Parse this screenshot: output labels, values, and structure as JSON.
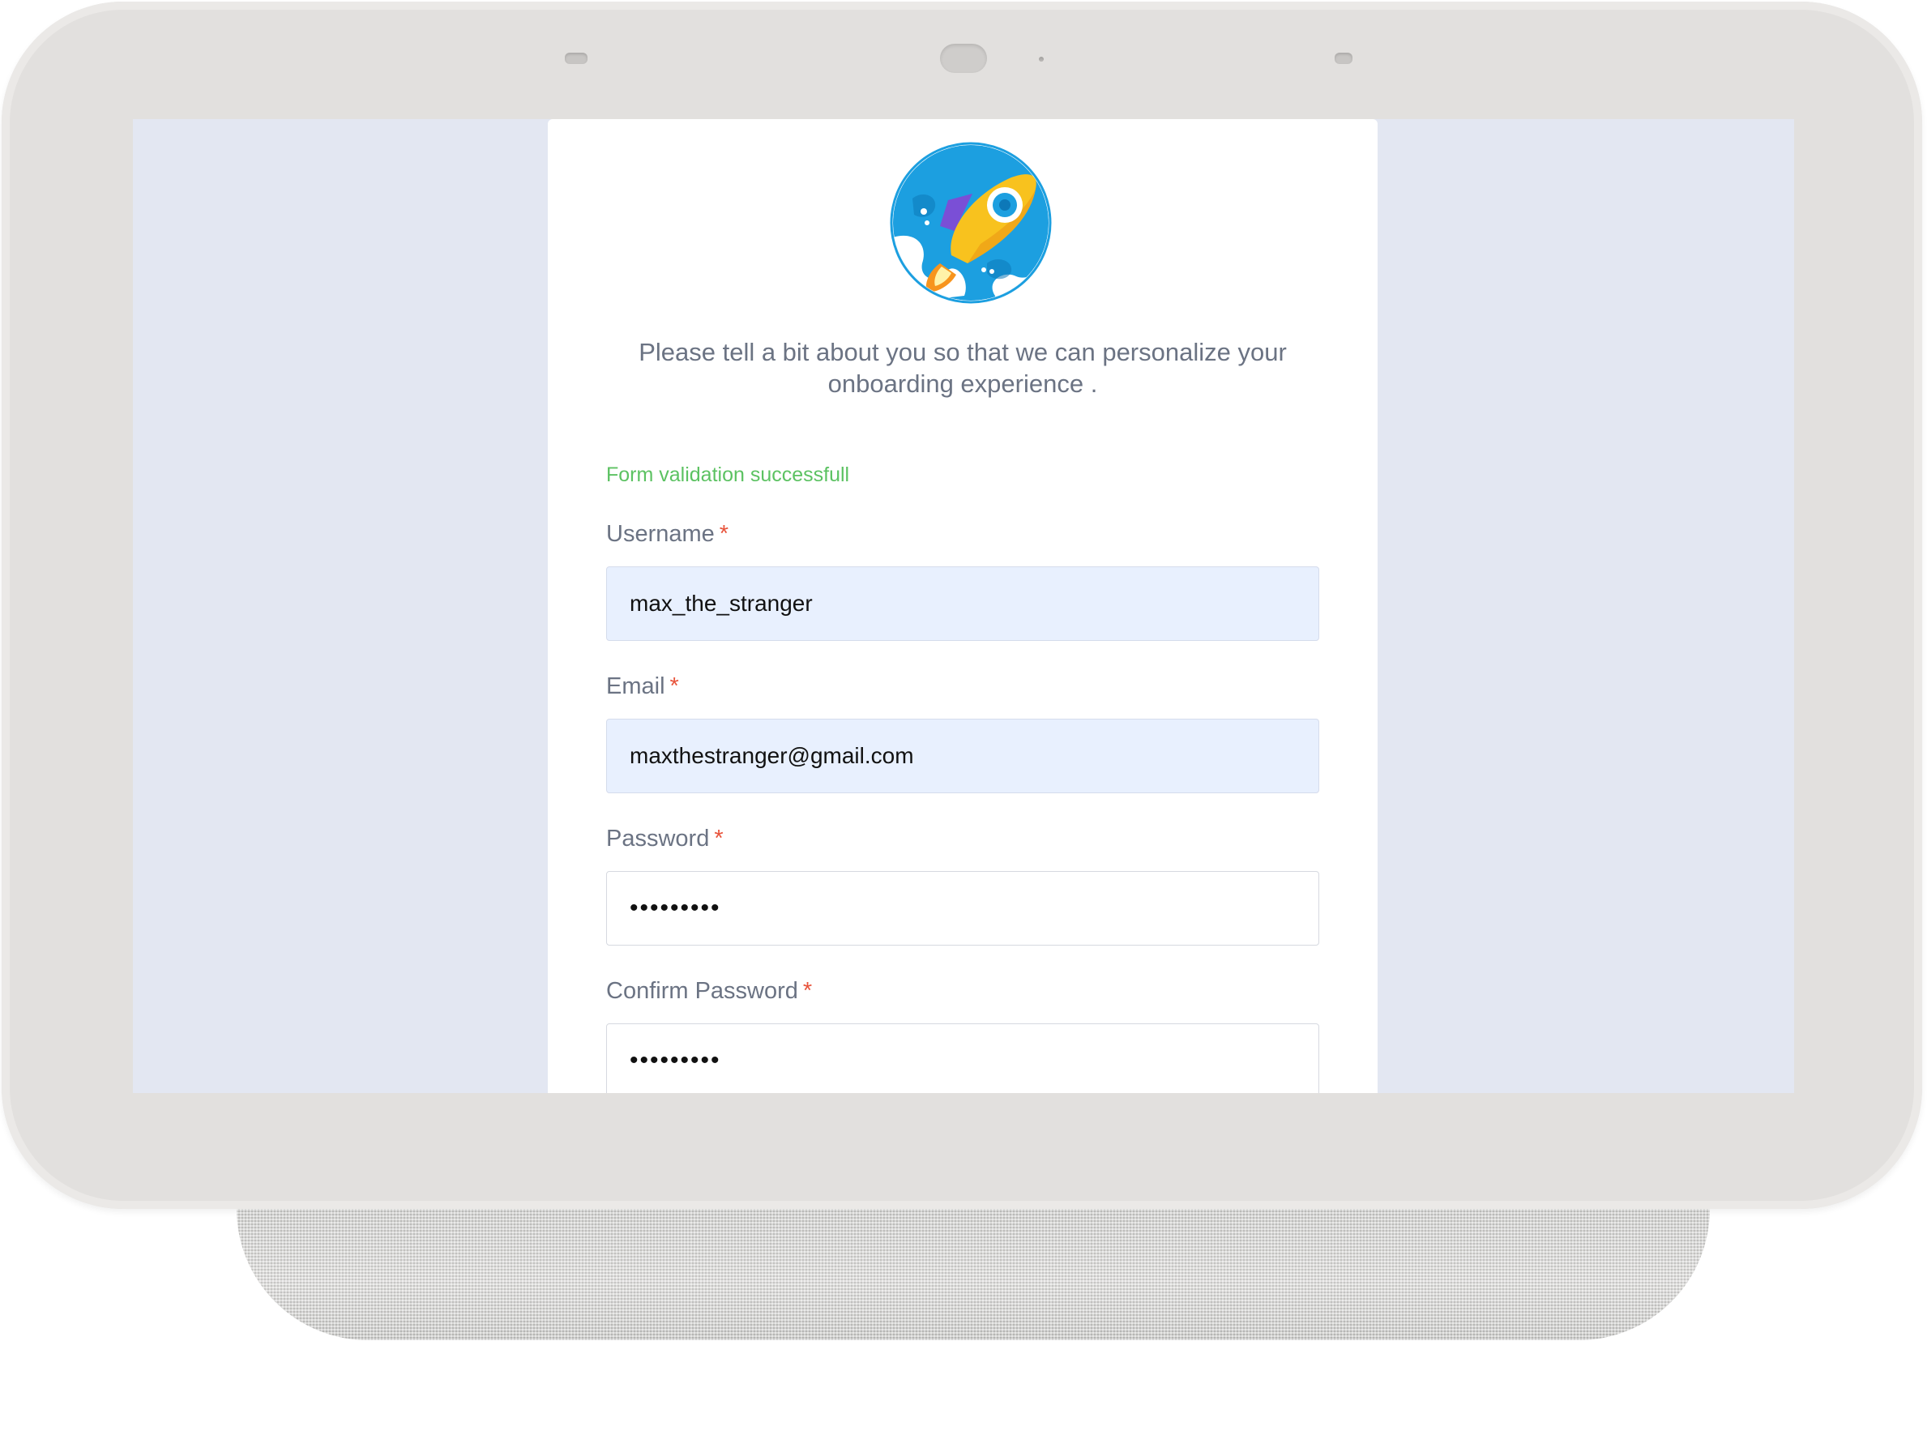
{
  "device": {
    "type": "smart display"
  },
  "logo": {
    "icon": "rocket-logo-icon",
    "colors": {
      "circle": "#1c9fe0",
      "body": "#f8c21e",
      "fin": "#7a4fd6",
      "flame": "#f7941d"
    }
  },
  "intro": {
    "text": "Please tell a bit about you so that we can personalize your onboarding experience ."
  },
  "form": {
    "status_text": "Form validation successfull",
    "status_color": "#5cc262",
    "required_marker": "*",
    "fields": [
      {
        "label": "Username",
        "value": "max_the_stranger",
        "type": "text"
      },
      {
        "label": "Email",
        "value": "maxthestranger@gmail.com",
        "type": "email"
      },
      {
        "label": "Password",
        "value": "passwords",
        "type": "password"
      },
      {
        "label": "Confirm Password",
        "value": "passwords",
        "type": "password"
      }
    ]
  },
  "colors": {
    "screen_background": "#e3e7f2",
    "card_background": "#ffffff",
    "autofill_background": "#e8f0fe",
    "label_text": "#6b7383",
    "required_marker": "#e8543c"
  }
}
